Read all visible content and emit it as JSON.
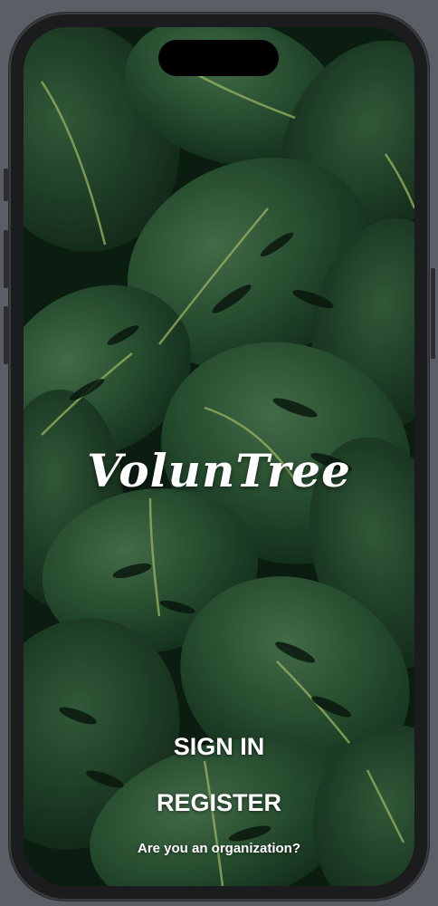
{
  "app": {
    "logo_text": "VolunTree"
  },
  "actions": {
    "sign_in_label": "SIGN IN",
    "register_label": "REGISTER",
    "organization_label": "Are you an organization?"
  },
  "colors": {
    "background_leaf": "#2f5a3a",
    "background_dark": "#0f2417",
    "text": "#ffffff"
  }
}
